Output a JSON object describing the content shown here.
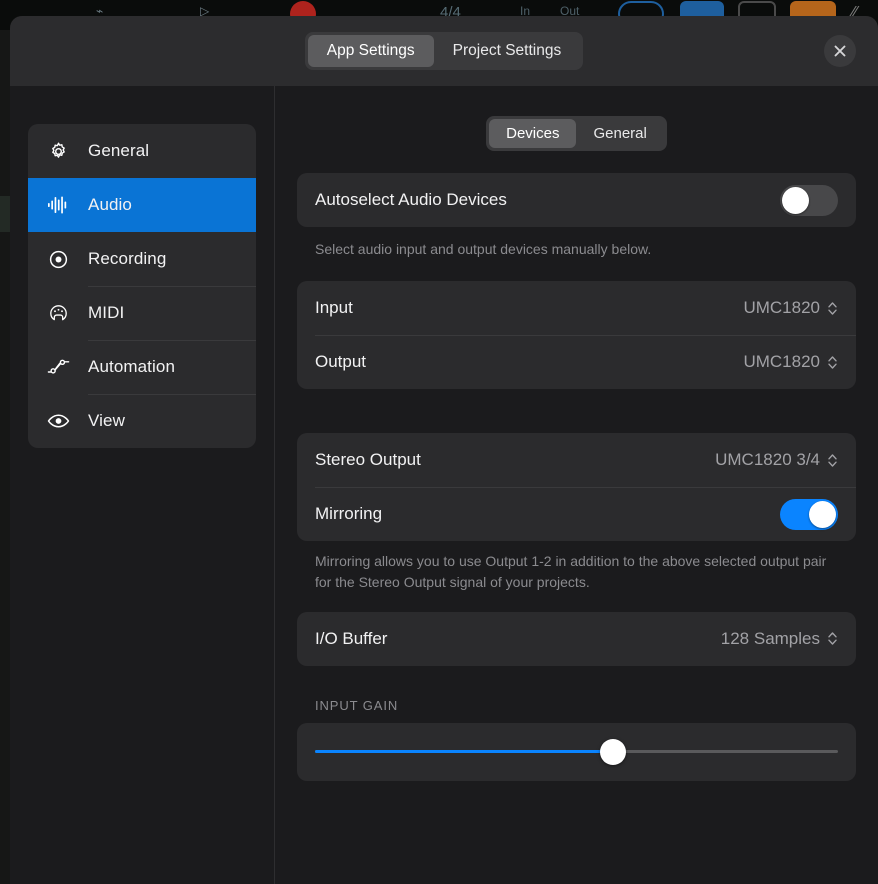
{
  "background": {
    "time_signature": "4/4",
    "in_label": "In",
    "out_label": "Out",
    "accent_blue": "#1e5f9e",
    "accent_orange": "#b5651b",
    "accent_red": "#c0261f"
  },
  "header": {
    "scope_tabs": [
      {
        "label": "App Settings",
        "active": true
      },
      {
        "label": "Project Settings",
        "active": false
      }
    ],
    "close_icon": "close-icon"
  },
  "sidebar": {
    "items": [
      {
        "label": "General",
        "icon": "gear-icon",
        "active": false
      },
      {
        "label": "Audio",
        "icon": "waveform-icon",
        "active": true
      },
      {
        "label": "Recording",
        "icon": "record-icon",
        "active": false
      },
      {
        "label": "MIDI",
        "icon": "midi-port-icon",
        "active": false
      },
      {
        "label": "Automation",
        "icon": "automation-icon",
        "active": false
      },
      {
        "label": "View",
        "icon": "eye-icon",
        "active": false
      }
    ]
  },
  "content": {
    "view_tabs": [
      {
        "label": "Devices",
        "active": true
      },
      {
        "label": "General",
        "active": false
      }
    ],
    "autoselect": {
      "label": "Autoselect Audio Devices",
      "enabled": false,
      "helper": "Select audio input and output devices manually below."
    },
    "devices": {
      "input": {
        "label": "Input",
        "value": "UMC1820"
      },
      "output": {
        "label": "Output",
        "value": "UMC1820"
      }
    },
    "stereo": {
      "output": {
        "label": "Stereo Output",
        "value": "UMC1820 3/4"
      },
      "mirroring": {
        "label": "Mirroring",
        "enabled": true
      },
      "helper": "Mirroring allows you to use Output 1-2 in addition to the above selected output pair for the Stereo Output signal of your projects."
    },
    "io_buffer": {
      "label": "I/O Buffer",
      "value": "128 Samples"
    },
    "input_gain": {
      "caption": "INPUT GAIN",
      "value_percent": 57
    }
  },
  "colors": {
    "accent": "#0a74d5",
    "toggle_on": "#0a84ff",
    "panel_bg": "#1b1b1d",
    "card_bg": "#2b2b2d",
    "header_bg": "#2c2c2e"
  }
}
